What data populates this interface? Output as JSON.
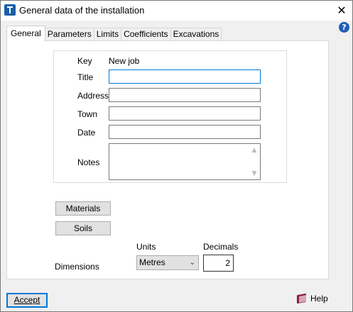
{
  "window": {
    "title": "General data of the installation",
    "close_glyph": "✕",
    "help_glyph": "?"
  },
  "tabs": [
    {
      "label": "General",
      "active": true
    },
    {
      "label": "Parameters",
      "active": false
    },
    {
      "label": "Limits",
      "active": false
    },
    {
      "label": "Coefficients",
      "active": false
    },
    {
      "label": "Excavations",
      "active": false
    }
  ],
  "form": {
    "key_label": "Key",
    "key_value": "New job",
    "title_label": "Title",
    "title_value": "",
    "address_label": "Address",
    "address_value": "",
    "town_label": "Town",
    "town_value": "",
    "date_label": "Date",
    "date_value": "",
    "notes_label": "Notes",
    "notes_value": ""
  },
  "buttons": {
    "materials": "Materials",
    "soils": "Soils"
  },
  "dimensions": {
    "label": "Dimensions",
    "units_label": "Units",
    "units_value": "Metres",
    "decimals_label": "Decimals",
    "decimals_value": "2"
  },
  "footer": {
    "accept": "Accept",
    "help": "Help"
  },
  "colors": {
    "focus_accent": "#0078d7",
    "help_badge": "#1f5fb5",
    "book_icon": "#8b1c4a"
  },
  "icons": {
    "app": "app-icon",
    "close": "close-icon",
    "help_badge": "help-circle-icon",
    "help_book": "book-icon",
    "dropdown": "chevron-down-icon"
  }
}
